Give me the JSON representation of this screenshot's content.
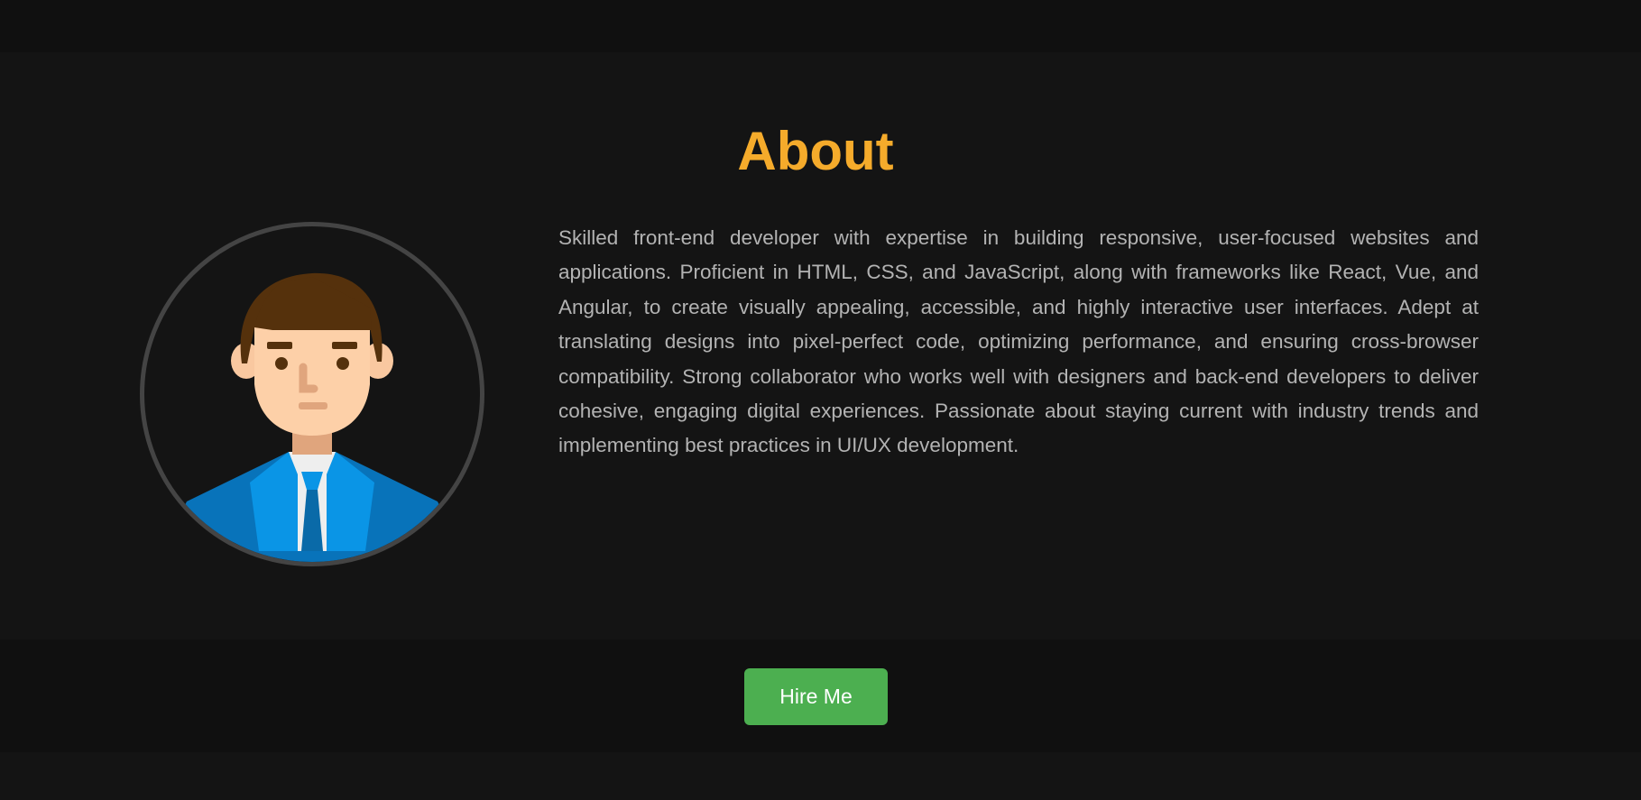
{
  "about": {
    "title": "About",
    "description": "Skilled front-end developer with expertise in building responsive, user-focused websites and applications. Proficient in HTML, CSS, and JavaScript, along with frameworks like React, Vue, and Angular, to create visually appealing, accessible, and highly interactive user interfaces. Adept at translating designs into pixel-perfect code, optimizing performance, and ensuring cross-browser compatibility. Strong collaborator who works well with designers and back-end developers to deliver cohesive, engaging digital experiences. Passionate about staying current with industry trends and implementing best practices in UI/UX development.",
    "avatar_icon": "developer-avatar-icon"
  },
  "cta": {
    "hire_label": "Hire Me"
  },
  "colors": {
    "accent": "#f5ab2b",
    "button": "#4caf50",
    "background": "#141414",
    "text": "#b3b3b3"
  }
}
